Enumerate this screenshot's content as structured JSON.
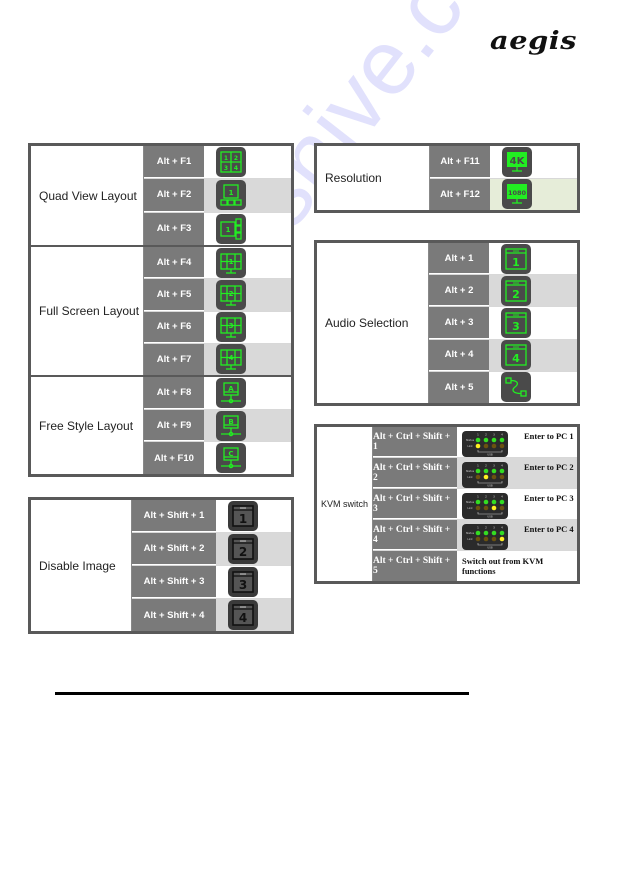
{
  "header": {
    "logo": "aegis"
  },
  "watermark": "manualshive.com",
  "tables": {
    "quad": {
      "title": "Quad View Layout",
      "rows": [
        {
          "key": "Alt + F1",
          "icon": "quad-view-4-icon"
        },
        {
          "key": "Alt + F2",
          "icon": "quad-view-1-main-3-bottom-icon"
        },
        {
          "key": "Alt + F3",
          "icon": "quad-view-1-main-3-side-icon"
        }
      ]
    },
    "full": {
      "title": "Full Screen Layout",
      "rows": [
        {
          "key": "Alt + F4",
          "icon": "full-screen-1-icon",
          "label": "1"
        },
        {
          "key": "Alt + F5",
          "icon": "full-screen-2-icon",
          "label": "2"
        },
        {
          "key": "Alt + F6",
          "icon": "full-screen-3-icon",
          "label": "3"
        },
        {
          "key": "Alt + F7",
          "icon": "full-screen-4-icon",
          "label": "4"
        }
      ]
    },
    "free": {
      "title": "Free Style Layout",
      "rows": [
        {
          "key": "Alt + F8",
          "icon": "free-style-a-icon",
          "label": "A"
        },
        {
          "key": "Alt + F9",
          "icon": "free-style-b-icon",
          "label": "B"
        },
        {
          "key": "Alt + F10",
          "icon": "free-style-c-icon",
          "label": "C"
        }
      ]
    },
    "disable": {
      "title": "Disable Image",
      "rows": [
        {
          "key": "Alt + Shift + 1",
          "icon": "disable-image-1-icon",
          "label": "1"
        },
        {
          "key": "Alt + Shift + 2",
          "icon": "disable-image-2-icon",
          "label": "2"
        },
        {
          "key": "Alt + Shift + 3",
          "icon": "disable-image-3-icon",
          "label": "3"
        },
        {
          "key": "Alt + Shift + 4",
          "icon": "disable-image-4-icon",
          "label": "4"
        }
      ]
    },
    "resolution": {
      "title": "Resolution",
      "rows": [
        {
          "key": "Alt + F11",
          "icon": "resolution-4k-icon",
          "label": "4K"
        },
        {
          "key": "Alt + F12",
          "icon": "resolution-1080-icon",
          "label": "1080"
        }
      ]
    },
    "audio": {
      "title": "Audio Selection",
      "rows": [
        {
          "key": "Alt + 1",
          "icon": "audio-source-1-icon",
          "label": "1"
        },
        {
          "key": "Alt + 2",
          "icon": "audio-source-2-icon",
          "label": "2"
        },
        {
          "key": "Alt + 3",
          "icon": "audio-source-3-icon",
          "label": "3"
        },
        {
          "key": "Alt + 4",
          "icon": "audio-source-4-icon",
          "label": "4"
        },
        {
          "key": "Alt + 5",
          "icon": "audio-cable-icon"
        }
      ]
    },
    "kvm": {
      "title": "KVM switch",
      "rows": [
        {
          "key": "Alt + Ctrl + Shift + 1",
          "text": "Enter to PC 1",
          "active_link": 1
        },
        {
          "key": "Alt + Ctrl + Shift + 2",
          "text": "Enter to PC 2",
          "active_link": 2
        },
        {
          "key": "Alt + Ctrl + Shift + 3",
          "text": "Enter to PC 3",
          "active_link": 3
        },
        {
          "key": "Alt + Ctrl + Shift + 4",
          "text": "Enter to PC 4",
          "active_link": 4
        },
        {
          "key": "Alt + Ctrl + Shift + 5",
          "text": "Switch out from KVM functions"
        }
      ],
      "led_labels": {
        "status": "Status",
        "link": "Link",
        "usb": "USB",
        "ports": [
          "1",
          "2",
          "3",
          "4"
        ]
      }
    }
  },
  "colors": {
    "icon_green": "#22ee22",
    "icon_bg": "#4a4a4a",
    "key_bg": "#7a7a7a",
    "border": "#595959",
    "led_green": "#33dd22",
    "led_yellow": "#ffee22",
    "led_off": "#6b5210"
  }
}
